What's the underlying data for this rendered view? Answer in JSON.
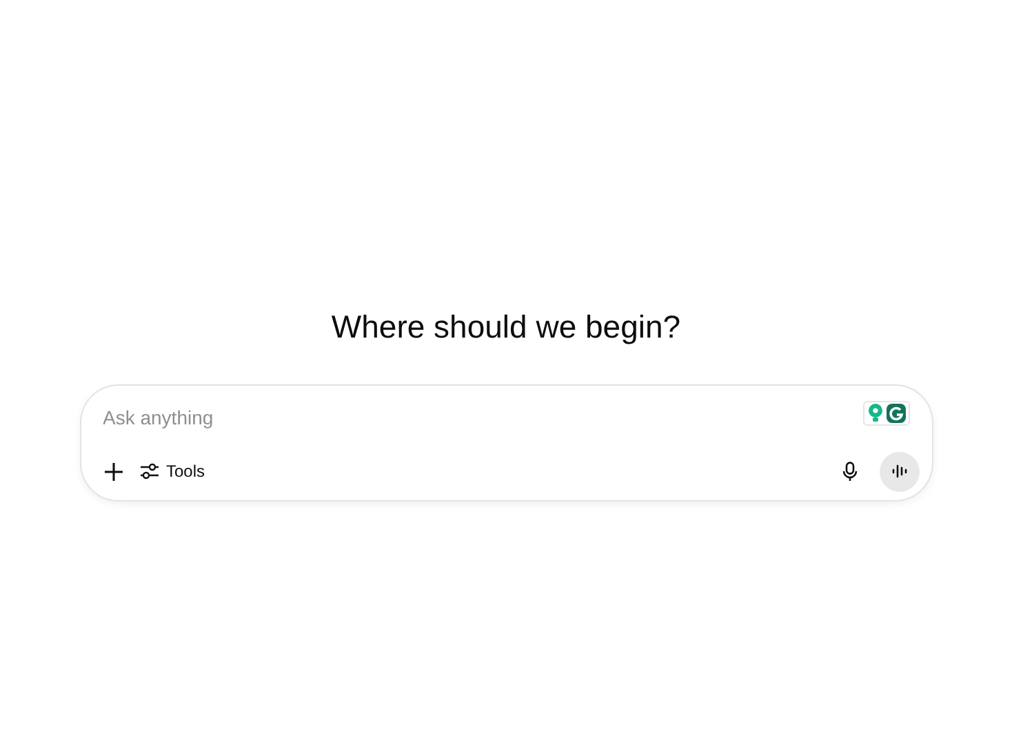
{
  "heading": "Where should we begin?",
  "composer": {
    "placeholder": "Ask anything",
    "tools_label": "Tools"
  }
}
